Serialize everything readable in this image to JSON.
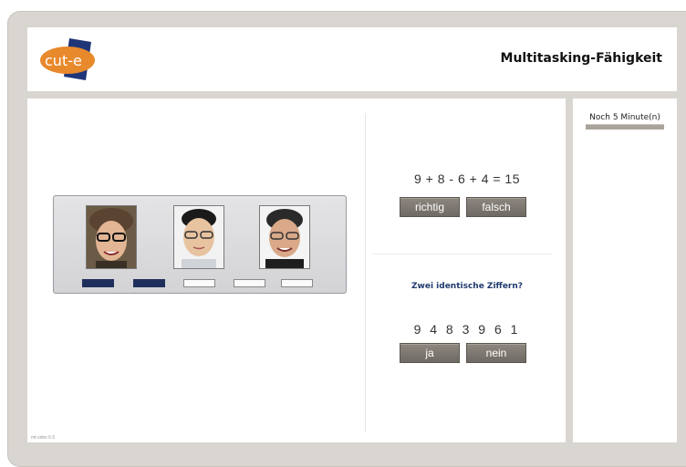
{
  "header": {
    "logo_text": "cut-e",
    "title": "Multitasking-Fähigkeit"
  },
  "timer": {
    "text": "Noch 5 Minute(n)"
  },
  "faces_task": {
    "faces": [
      "face-man-glasses-curly-hair",
      "face-man-glasses-black-hair",
      "face-man-glasses-grey-hair"
    ],
    "slots": [
      {
        "state": "filled"
      },
      {
        "state": "filled"
      },
      {
        "state": "empty"
      },
      {
        "state": "empty"
      },
      {
        "state": "empty"
      }
    ]
  },
  "math_task": {
    "equation": "9 + 8 - 6 + 4 = 15",
    "correct_label": "richtig",
    "wrong_label": "falsch"
  },
  "digit_task": {
    "question": "Zwei identische Ziffern?",
    "digits": "9 4 8 3 9 6 1",
    "yes_label": "ja",
    "no_label": "nein"
  },
  "footer": {
    "version": "mt-sdes 6.5"
  },
  "colors": {
    "frame": "#d9d6d1",
    "button": "#7c7670",
    "slot_filled": "#1f2f5c",
    "question_text": "#1f3a6e",
    "logo_orange": "#e8892c",
    "logo_blue": "#1f3578"
  }
}
